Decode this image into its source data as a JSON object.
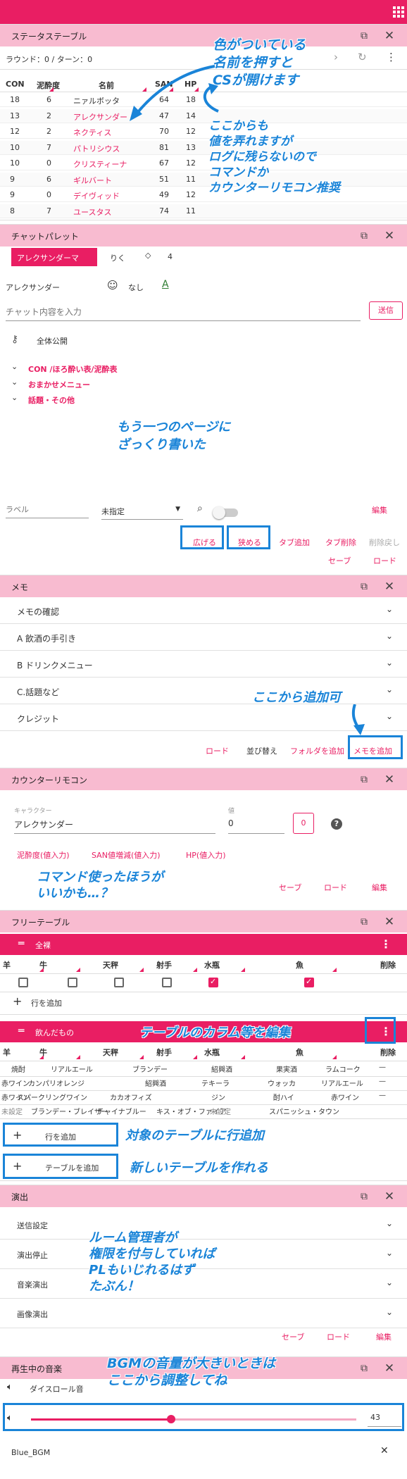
{
  "status": {
    "title": "ステータステーブル",
    "round": "ラウンド：0 / ターン：0",
    "headers": [
      "CON",
      "泥酔度",
      "名前",
      "SAN",
      "HP"
    ],
    "rows": [
      {
        "con": "18",
        "dei": "6",
        "name": "ニァルボッタ",
        "san": "64",
        "hp": "18"
      },
      {
        "con": "13",
        "dei": "2",
        "name": "アレクサンダー",
        "san": "47",
        "hp": "14"
      },
      {
        "con": "12",
        "dei": "2",
        "name": "ネクティス",
        "san": "70",
        "hp": "12"
      },
      {
        "con": "10",
        "dei": "7",
        "name": "パトリシウス",
        "san": "81",
        "hp": "13"
      },
      {
        "con": "10",
        "dei": "0",
        "name": "クリスティーナ",
        "san": "67",
        "hp": "12"
      },
      {
        "con": "9",
        "dei": "6",
        "name": "ギルバート",
        "san": "51",
        "hp": "11"
      },
      {
        "con": "9",
        "dei": "0",
        "name": "デイヴィッド",
        "san": "49",
        "hp": "12"
      },
      {
        "con": "8",
        "dei": "7",
        "name": "ユースタス",
        "san": "74",
        "hp": "11"
      }
    ]
  },
  "chat": {
    "title": "チャットパレット",
    "tab_active": "アレクサンダーマ",
    "tab2": "りく",
    "tab3": "4",
    "char_name": "アレクサンダー",
    "face": "なし",
    "placeholder": "チャット内容を入力",
    "send": "送信",
    "scope": "全体公開",
    "groups": [
      "CON /ほろ酔い表/泥酔表",
      "おまかせメニュー",
      "話題・その他"
    ],
    "label_placeholder": "ラベル",
    "unspecified": "未指定",
    "edit": "編集",
    "expand": "広げる",
    "narrow": "狭める",
    "add_tab": "タブ追加",
    "del_tab": "タブ削除",
    "undo": "削除戻し",
    "save": "セーブ",
    "load": "ロード"
  },
  "memo": {
    "title": "メモ",
    "items": [
      "メモの確認",
      "A 飲酒の手引き",
      "B ドリンクメニュー",
      "C.話題など",
      "クレジット"
    ],
    "load": "ロード",
    "sort": "並び替え",
    "add_folder": "フォルダを追加",
    "add_memo": "メモを追加"
  },
  "counter": {
    "title": "カウンターリモコン",
    "char_label": "キャラクター",
    "char_value": "アレクサンダー",
    "val_label": "値",
    "val_value": "0",
    "btn_value": "0",
    "b1": "泥酔度(値入力)",
    "b2": "SAN値増減(値入力)",
    "b3": "HP(値入力)",
    "save": "セーブ",
    "load": "ロード",
    "edit": "編集"
  },
  "free": {
    "title": "フリーテーブル",
    "t1_name": "全裸",
    "t1_headers": [
      "羊",
      "牛",
      "天秤",
      "射手",
      "水瓶",
      "魚",
      "削除"
    ],
    "add_row": "行を追加",
    "t2_name": "飲んだもの",
    "t2_headers": [
      "羊",
      "牛",
      "天秤",
      "射手",
      "水瓶",
      "魚",
      "削除"
    ],
    "t2_rows": [
      [
        "焼酎",
        "リアルエール",
        "ブランデー",
        "紹興酒",
        "果実酒",
        "ラムコーク",
        "—"
      ],
      [
        "赤ワイン",
        "カンパリオレンジ",
        "紹興酒",
        "テキーラ",
        "ウォッカ",
        "リアルエール",
        "—"
      ],
      [
        "赤ワイン",
        "スパークリングワイン",
        "カカオフィズ",
        "ジン",
        "酎ハイ",
        "赤ワイン",
        "—"
      ],
      [
        "未設定",
        "ブランデー・ブレイザー",
        "チャイナブルー",
        "キス・オブ・ファイア",
        "未設定",
        "スパニッシュ・タウン",
        ""
      ]
    ],
    "add_row2": "行を追加",
    "add_table": "テーブルを追加"
  },
  "stage": {
    "title": "演出",
    "items": [
      "送信設定",
      "演出停止",
      "音楽演出",
      "画像演出"
    ],
    "save": "セーブ",
    "load": "ロード",
    "edit": "編集"
  },
  "music": {
    "title": "再生中の音楽",
    "track1": "ダイスロール音",
    "volume": "43",
    "volume_level": 0.43,
    "track2": "Blue_BGM"
  },
  "annotations": {
    "a1": "色がついている\n名前を押すと\nCSが開けます",
    "a2": "ここからも\n値を弄れますが\nログに残らないので\nコマンドか\nカウンターリモコン推奨",
    "a3": "もう一つのページに\nざっくり書いた",
    "a4": "ここから追加可",
    "a5": "コマンド使ったほうが\nいいかも…？",
    "a6": "テーブルのカラム等を編集",
    "a7": "対象のテーブルに行追加",
    "a8": "新しいテーブルを作れる",
    "a9": "ルーム管理者が\n権限を付与していれば\nPLもいじれるはず\nたぶん！",
    "a10": "BGMの音量が大きいときは\nここから調整してね"
  },
  "colors": {
    "accent": "#e91e63",
    "header": "#f8bbd0",
    "annotation": "#1a84d8"
  }
}
